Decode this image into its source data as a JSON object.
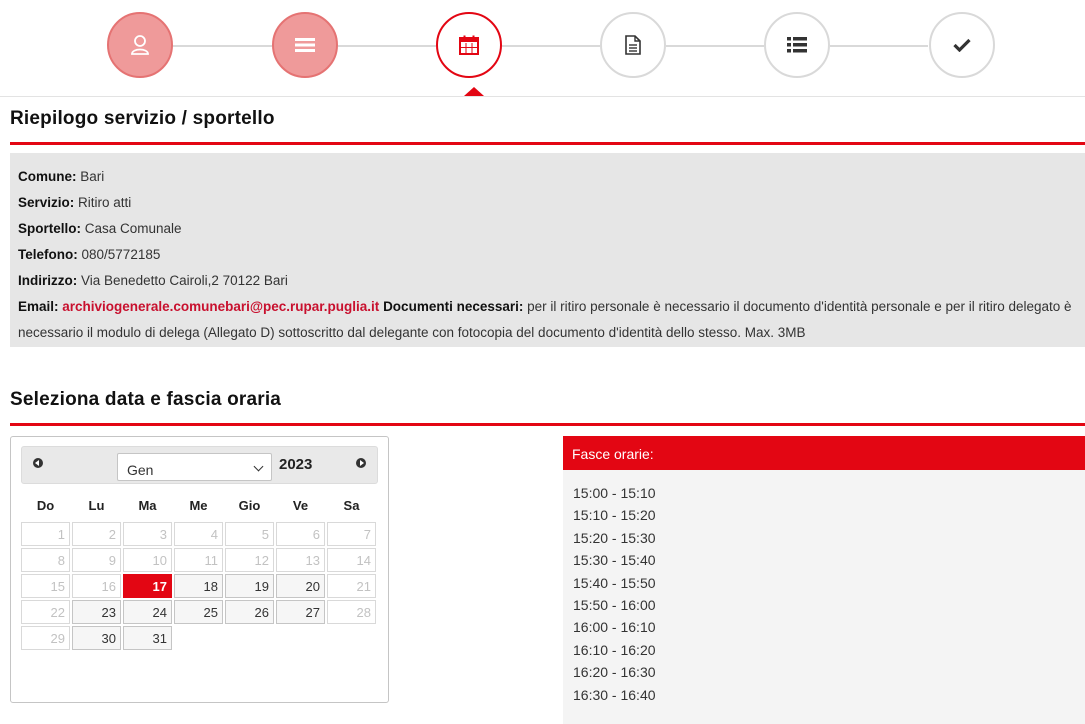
{
  "steps": [
    {
      "icon": "user-icon",
      "state": "done"
    },
    {
      "icon": "menu-icon",
      "state": "done"
    },
    {
      "icon": "calendar-icon",
      "state": "active"
    },
    {
      "icon": "document-icon",
      "state": "todo"
    },
    {
      "icon": "list-icon",
      "state": "todo"
    },
    {
      "icon": "check-icon",
      "state": "todo"
    }
  ],
  "summary": {
    "title": "Riepilogo servizio / sportello",
    "comune_label": "Comune:",
    "comune": "Bari",
    "servizio_label": "Servizio:",
    "servizio": "Ritiro atti",
    "sportello_label": "Sportello:",
    "sportello": "Casa Comunale",
    "telefono_label": "Telefono:",
    "telefono": "080/5772185",
    "indirizzo_label": "Indirizzo:",
    "indirizzo": "Via Benedetto Cairoli,2 70122 Bari",
    "email_label": "Email:",
    "email": "archiviogenerale.comunebari@pec.rupar.puglia.it",
    "documenti_label": "Documenti necessari:",
    "documenti": "per il ritiro personale è necessario il documento d'identità personale e per il ritiro delegato è necessario il modulo di delega (Allegato D) sottoscritto dal delegante con fotocopia del documento d'identità dello stesso. Max. 3MB"
  },
  "booking": {
    "title": "Seleziona data e fascia oraria"
  },
  "calendar": {
    "month": "Gen",
    "year": "2023",
    "weekdays": [
      "Do",
      "Lu",
      "Ma",
      "Me",
      "Gio",
      "Ve",
      "Sa"
    ],
    "weeks": [
      [
        {
          "d": "1",
          "s": "disabled"
        },
        {
          "d": "2",
          "s": "disabled"
        },
        {
          "d": "3",
          "s": "disabled"
        },
        {
          "d": "4",
          "s": "disabled"
        },
        {
          "d": "5",
          "s": "disabled"
        },
        {
          "d": "6",
          "s": "disabled"
        },
        {
          "d": "7",
          "s": "disabled"
        }
      ],
      [
        {
          "d": "8",
          "s": "disabled"
        },
        {
          "d": "9",
          "s": "disabled"
        },
        {
          "d": "10",
          "s": "disabled"
        },
        {
          "d": "11",
          "s": "disabled"
        },
        {
          "d": "12",
          "s": "disabled"
        },
        {
          "d": "13",
          "s": "disabled"
        },
        {
          "d": "14",
          "s": "disabled"
        }
      ],
      [
        {
          "d": "15",
          "s": "disabled"
        },
        {
          "d": "16",
          "s": "disabled"
        },
        {
          "d": "17",
          "s": "selected"
        },
        {
          "d": "18",
          "s": "available"
        },
        {
          "d": "19",
          "s": "available"
        },
        {
          "d": "20",
          "s": "available"
        },
        {
          "d": "21",
          "s": "disabled"
        }
      ],
      [
        {
          "d": "22",
          "s": "disabled"
        },
        {
          "d": "23",
          "s": "available"
        },
        {
          "d": "24",
          "s": "available"
        },
        {
          "d": "25",
          "s": "available"
        },
        {
          "d": "26",
          "s": "available"
        },
        {
          "d": "27",
          "s": "available"
        },
        {
          "d": "28",
          "s": "disabled"
        }
      ],
      [
        {
          "d": "29",
          "s": "disabled"
        },
        {
          "d": "30",
          "s": "available"
        },
        {
          "d": "31",
          "s": "available"
        },
        {
          "d": "",
          "s": "blank"
        },
        {
          "d": "",
          "s": "blank"
        },
        {
          "d": "",
          "s": "blank"
        },
        {
          "d": "",
          "s": "blank"
        }
      ]
    ]
  },
  "slots": {
    "header": "Fasce orarie:",
    "items": [
      "15:00 - 15:10",
      "15:10 - 15:20",
      "15:20 - 15:30",
      "15:30 - 15:40",
      "15:40 - 15:50",
      "15:50 - 16:00",
      "16:00 - 16:10",
      "16:10 - 16:20",
      "16:20 - 16:30",
      "16:30 - 16:40"
    ]
  },
  "colors": {
    "accent": "#e30613",
    "done_step": "#ef9a9a",
    "summary_bg": "#e6e6e6"
  }
}
